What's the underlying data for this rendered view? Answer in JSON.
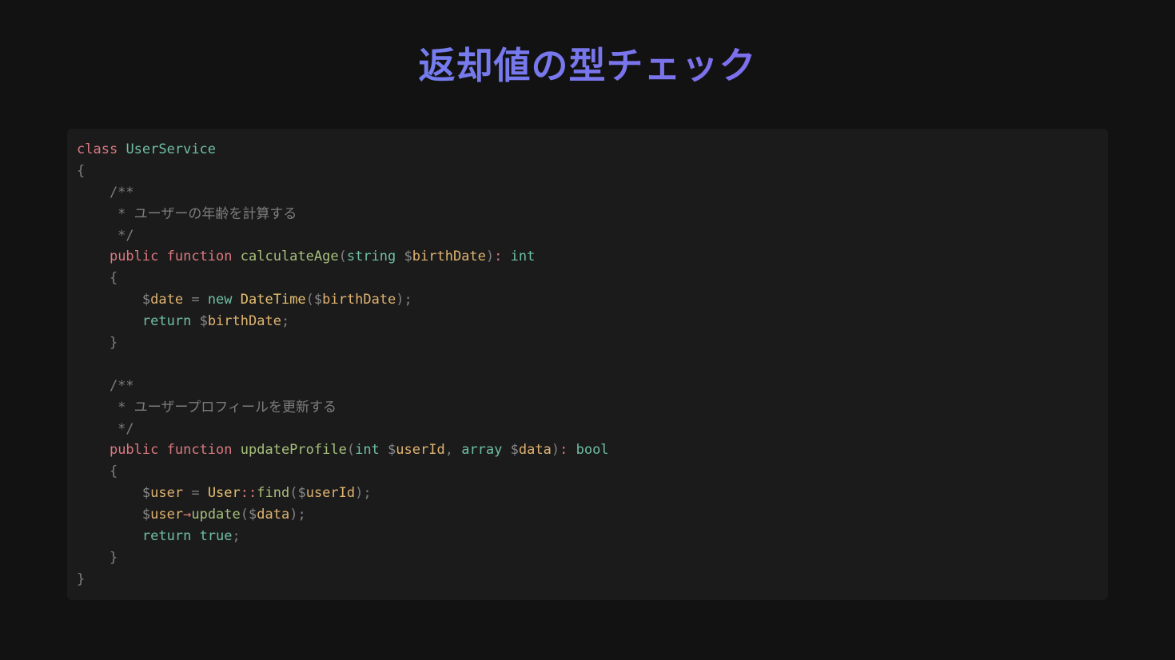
{
  "slide": {
    "title": "返却値の型チェック"
  },
  "code": {
    "language": "php",
    "lines": [
      [
        {
          "t": "class",
          "k": "kw"
        },
        {
          "t": " ",
          "k": "punct"
        },
        {
          "t": "UserService",
          "k": "cls"
        }
      ],
      [
        {
          "t": "{",
          "k": "punct"
        }
      ],
      [
        {
          "t": "    /**",
          "k": "comment"
        }
      ],
      [
        {
          "t": "     * ",
          "k": "comment"
        },
        {
          "t": "ユーザーの年齢を計算する",
          "k": "comment jp"
        }
      ],
      [
        {
          "t": "     */",
          "k": "comment"
        }
      ],
      [
        {
          "t": "    ",
          "k": "punct"
        },
        {
          "t": "public",
          "k": "kw"
        },
        {
          "t": " ",
          "k": "punct"
        },
        {
          "t": "function",
          "k": "kw"
        },
        {
          "t": " ",
          "k": "punct"
        },
        {
          "t": "calculateAge",
          "k": "fn"
        },
        {
          "t": "(",
          "k": "punct"
        },
        {
          "t": "string",
          "k": "type"
        },
        {
          "t": " ",
          "k": "punct"
        },
        {
          "t": "$",
          "k": "dollar"
        },
        {
          "t": "birthDate",
          "k": "var"
        },
        {
          "t": ")",
          "k": "punct"
        },
        {
          "t": ":",
          "k": "op"
        },
        {
          "t": " ",
          "k": "punct"
        },
        {
          "t": "int",
          "k": "type"
        }
      ],
      [
        {
          "t": "    {",
          "k": "punct"
        }
      ],
      [
        {
          "t": "        ",
          "k": "punct"
        },
        {
          "t": "$",
          "k": "dollar"
        },
        {
          "t": "date",
          "k": "var"
        },
        {
          "t": " = ",
          "k": "punct"
        },
        {
          "t": "new",
          "k": "new"
        },
        {
          "t": " ",
          "k": "punct"
        },
        {
          "t": "DateTime",
          "k": "ctor"
        },
        {
          "t": "(",
          "k": "punct"
        },
        {
          "t": "$",
          "k": "dollar"
        },
        {
          "t": "birthDate",
          "k": "var"
        },
        {
          "t": ");",
          "k": "punct"
        }
      ],
      [
        {
          "t": "        ",
          "k": "punct"
        },
        {
          "t": "return",
          "k": "ret"
        },
        {
          "t": " ",
          "k": "punct"
        },
        {
          "t": "$",
          "k": "dollar"
        },
        {
          "t": "birthDate",
          "k": "var"
        },
        {
          "t": ";",
          "k": "punct"
        }
      ],
      [
        {
          "t": "    }",
          "k": "punct"
        }
      ],
      [
        {
          "t": "",
          "k": "punct"
        }
      ],
      [
        {
          "t": "    /**",
          "k": "comment"
        }
      ],
      [
        {
          "t": "     * ",
          "k": "comment"
        },
        {
          "t": "ユーザープロフィールを更新する",
          "k": "comment jp"
        }
      ],
      [
        {
          "t": "     */",
          "k": "comment"
        }
      ],
      [
        {
          "t": "    ",
          "k": "punct"
        },
        {
          "t": "public",
          "k": "kw"
        },
        {
          "t": " ",
          "k": "punct"
        },
        {
          "t": "function",
          "k": "kw"
        },
        {
          "t": " ",
          "k": "punct"
        },
        {
          "t": "updateProfile",
          "k": "fn"
        },
        {
          "t": "(",
          "k": "punct"
        },
        {
          "t": "int",
          "k": "type"
        },
        {
          "t": " ",
          "k": "punct"
        },
        {
          "t": "$",
          "k": "dollar"
        },
        {
          "t": "userId",
          "k": "var"
        },
        {
          "t": ", ",
          "k": "punct"
        },
        {
          "t": "array",
          "k": "type"
        },
        {
          "t": " ",
          "k": "punct"
        },
        {
          "t": "$",
          "k": "dollar"
        },
        {
          "t": "data",
          "k": "var"
        },
        {
          "t": ")",
          "k": "punct"
        },
        {
          "t": ":",
          "k": "op"
        },
        {
          "t": " ",
          "k": "punct"
        },
        {
          "t": "bool",
          "k": "type"
        }
      ],
      [
        {
          "t": "    {",
          "k": "punct"
        }
      ],
      [
        {
          "t": "        ",
          "k": "punct"
        },
        {
          "t": "$",
          "k": "dollar"
        },
        {
          "t": "user",
          "k": "var"
        },
        {
          "t": " = ",
          "k": "punct"
        },
        {
          "t": "User",
          "k": "static"
        },
        {
          "t": "::",
          "k": "dcolon"
        },
        {
          "t": "find",
          "k": "fn"
        },
        {
          "t": "(",
          "k": "punct"
        },
        {
          "t": "$",
          "k": "dollar"
        },
        {
          "t": "userId",
          "k": "var"
        },
        {
          "t": ");",
          "k": "punct"
        }
      ],
      [
        {
          "t": "        ",
          "k": "punct"
        },
        {
          "t": "$",
          "k": "dollar"
        },
        {
          "t": "user",
          "k": "var"
        },
        {
          "t": "→",
          "k": "op"
        },
        {
          "t": "update",
          "k": "fn"
        },
        {
          "t": "(",
          "k": "punct"
        },
        {
          "t": "$",
          "k": "dollar"
        },
        {
          "t": "data",
          "k": "var"
        },
        {
          "t": ");",
          "k": "punct"
        }
      ],
      [
        {
          "t": "        ",
          "k": "punct"
        },
        {
          "t": "return",
          "k": "ret"
        },
        {
          "t": " ",
          "k": "punct"
        },
        {
          "t": "true",
          "k": "bool"
        },
        {
          "t": ";",
          "k": "punct"
        }
      ],
      [
        {
          "t": "    }",
          "k": "punct"
        }
      ],
      [
        {
          "t": "}",
          "k": "punct"
        }
      ]
    ]
  },
  "colors": {
    "background": "#121212",
    "panel": "#1b1b1b",
    "title_gradient_start": "#6a8cf0",
    "title_gradient_end": "#8b5cf0"
  }
}
